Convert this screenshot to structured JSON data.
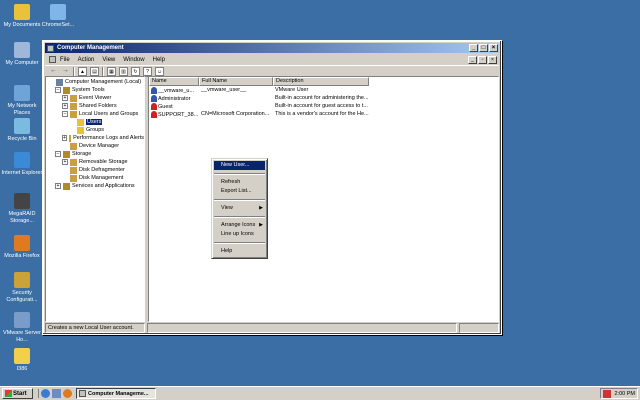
{
  "desktop": {
    "icons": [
      {
        "label": "My Documents",
        "name": "my-documents-icon"
      },
      {
        "label": "ChromeSet...",
        "name": "chromesetup-icon"
      },
      {
        "label": "My Computer",
        "name": "my-computer-icon"
      },
      {
        "label": "My Network Places",
        "name": "network-places-icon"
      },
      {
        "label": "Recycle Bin",
        "name": "recycle-bin-icon"
      },
      {
        "label": "Internet Explorer",
        "name": "internet-explorer-icon"
      },
      {
        "label": "MegaRAID Storage...",
        "name": "megaraid-icon"
      },
      {
        "label": "Mozilla Firefox",
        "name": "firefox-icon"
      },
      {
        "label": "Security Configurati...",
        "name": "security-config-icon"
      },
      {
        "label": "VMware Server Ho...",
        "name": "vmware-server-icon"
      },
      {
        "label": "I386",
        "name": "folder-icon"
      }
    ]
  },
  "window": {
    "title": "Computer Management",
    "menu": [
      "File",
      "Action",
      "View",
      "Window",
      "Help"
    ]
  },
  "tree": [
    {
      "label": "Computer Management (Local)",
      "level": 0,
      "expander": "",
      "name": "tree-root"
    },
    {
      "label": "System Tools",
      "level": 1,
      "expander": "−",
      "name": "tree-system-tools"
    },
    {
      "label": "Event Viewer",
      "level": 2,
      "expander": "+",
      "name": "tree-event-viewer"
    },
    {
      "label": "Shared Folders",
      "level": 2,
      "expander": "+",
      "name": "tree-shared-folders"
    },
    {
      "label": "Local Users and Groups",
      "level": 2,
      "expander": "−",
      "name": "tree-local-users-groups"
    },
    {
      "label": "Users",
      "level": 3,
      "expander": "",
      "name": "tree-users",
      "selected": true
    },
    {
      "label": "Groups",
      "level": 3,
      "expander": "",
      "name": "tree-groups"
    },
    {
      "label": "Performance Logs and Alerts",
      "level": 2,
      "expander": "+",
      "name": "tree-performance-logs"
    },
    {
      "label": "Device Manager",
      "level": 2,
      "expander": "",
      "name": "tree-device-manager"
    },
    {
      "label": "Storage",
      "level": 1,
      "expander": "−",
      "name": "tree-storage"
    },
    {
      "label": "Removable Storage",
      "level": 2,
      "expander": "+",
      "name": "tree-removable-storage"
    },
    {
      "label": "Disk Defragmenter",
      "level": 2,
      "expander": "",
      "name": "tree-disk-defragmenter"
    },
    {
      "label": "Disk Management",
      "level": 2,
      "expander": "",
      "name": "tree-disk-management"
    },
    {
      "label": "Services and Applications",
      "level": 1,
      "expander": "+",
      "name": "tree-services-apps"
    }
  ],
  "list": {
    "columns": [
      "Name",
      "Full Name",
      "Description"
    ],
    "rows": [
      {
        "name": "__vmware_u...",
        "full": "__vmware_user__",
        "desc": "VMware User",
        "icon": "#3355aa"
      },
      {
        "name": "Administrator",
        "full": "",
        "desc": "Built-in account for administering the...",
        "icon": "#3355aa"
      },
      {
        "name": "Guest",
        "full": "",
        "desc": "Built-in account for guest access to t...",
        "icon": "#cc2222"
      },
      {
        "name": "SUPPORT_38...",
        "full": "CN=Microsoft Corporation...",
        "desc": "This is a vendor's account for the He...",
        "icon": "#cc2222"
      }
    ]
  },
  "context_menu": {
    "items": [
      {
        "label": "New User...",
        "highlight": true,
        "submenu": false
      },
      {
        "sep": true
      },
      {
        "label": "Refresh",
        "submenu": false
      },
      {
        "label": "Export List...",
        "submenu": false
      },
      {
        "sep": true
      },
      {
        "label": "View",
        "submenu": true
      },
      {
        "sep": true
      },
      {
        "label": "Arrange Icons",
        "submenu": true
      },
      {
        "label": "Line up Icons",
        "submenu": false
      },
      {
        "sep": true
      },
      {
        "label": "Help",
        "submenu": false
      }
    ]
  },
  "status": {
    "text": "Creates a new Local User account."
  },
  "taskbar": {
    "start": "Start",
    "task": "Computer Manageme...",
    "time": "2:00 PM"
  },
  "colors": {
    "desktop": "#3a6ea5",
    "title_active": "#0a246a",
    "chrome": "#d4d0c8"
  }
}
